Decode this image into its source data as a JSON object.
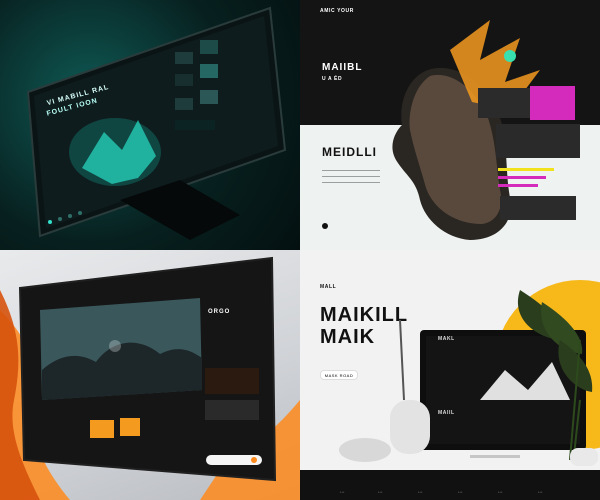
{
  "panel1": {
    "screen_title_line1": "VI MABILL RAL",
    "screen_title_line2": "FOULT IOON",
    "accent": "#33e0c9"
  },
  "panel2": {
    "brand": "AMIC YOUR",
    "title": "MAIIBL",
    "subtitle": "U  A  ÉD",
    "hero_title": "MEIDLLI",
    "accent_orange": "#f39a1f",
    "accent_magenta": "#d42bbd"
  },
  "panel3": {
    "header": "ORGO",
    "accent_orange": "#ff8a1c"
  },
  "panel4": {
    "brand": "MALL",
    "headline_line1": "MAIKILL",
    "headline_line2": "MAIK",
    "cta": "MASK ROAD",
    "monitor_label": "MAKL",
    "card_text": "MAIIL",
    "accent_yellow": "#f7b81a"
  }
}
